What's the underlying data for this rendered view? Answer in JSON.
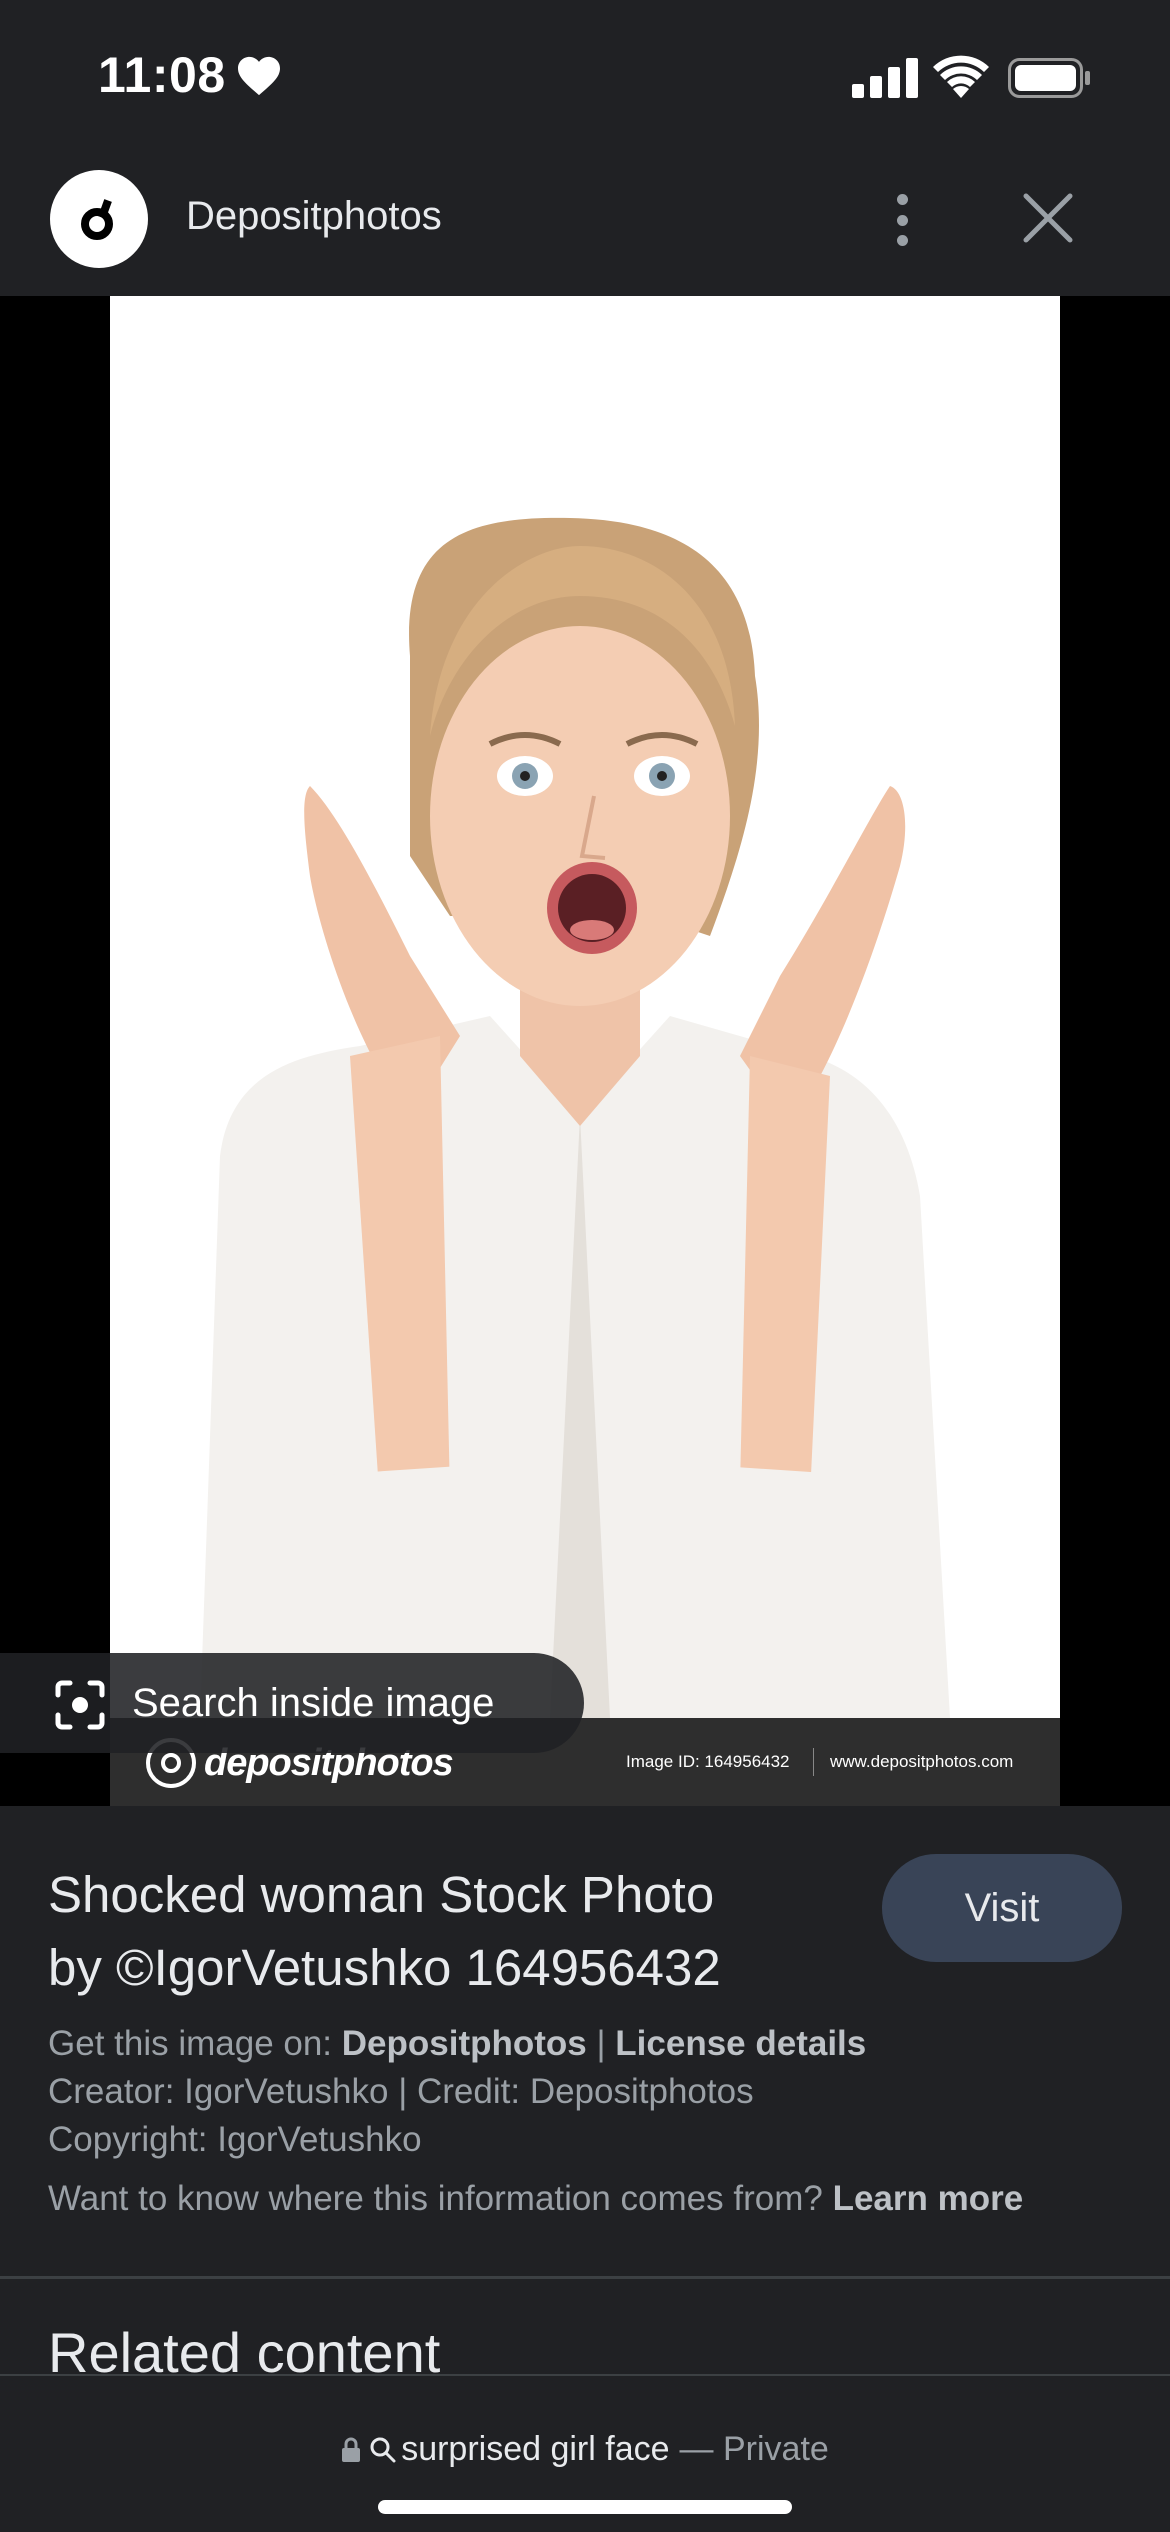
{
  "status_bar": {
    "time": "11:08"
  },
  "header": {
    "site_name": "Depositphotos"
  },
  "image": {
    "watermark_logo": "depositphotos",
    "watermark_id": "Image ID: 164956432",
    "watermark_url": "www.depositphotos.com",
    "search_inside_label": "Search inside image"
  },
  "info": {
    "title_line1": "Shocked woman Stock Photo",
    "title_line2": "by ©IgorVetushko 164956432",
    "visit_label": "Visit",
    "get_image_prefix": "Get this image on: ",
    "get_image_source": "Depositphotos",
    "separator": " | ",
    "license_details": "License details",
    "creator_credit": "Creator: IgorVetushko | Credit: Depositphotos",
    "copyright": "Copyright: IgorVetushko",
    "info_question": "Want to know where this information comes from? ",
    "learn_more": "Learn more"
  },
  "related": {
    "heading": "Related content"
  },
  "bottom_bar": {
    "query": "surprised girl face",
    "private_label": "— Private"
  }
}
